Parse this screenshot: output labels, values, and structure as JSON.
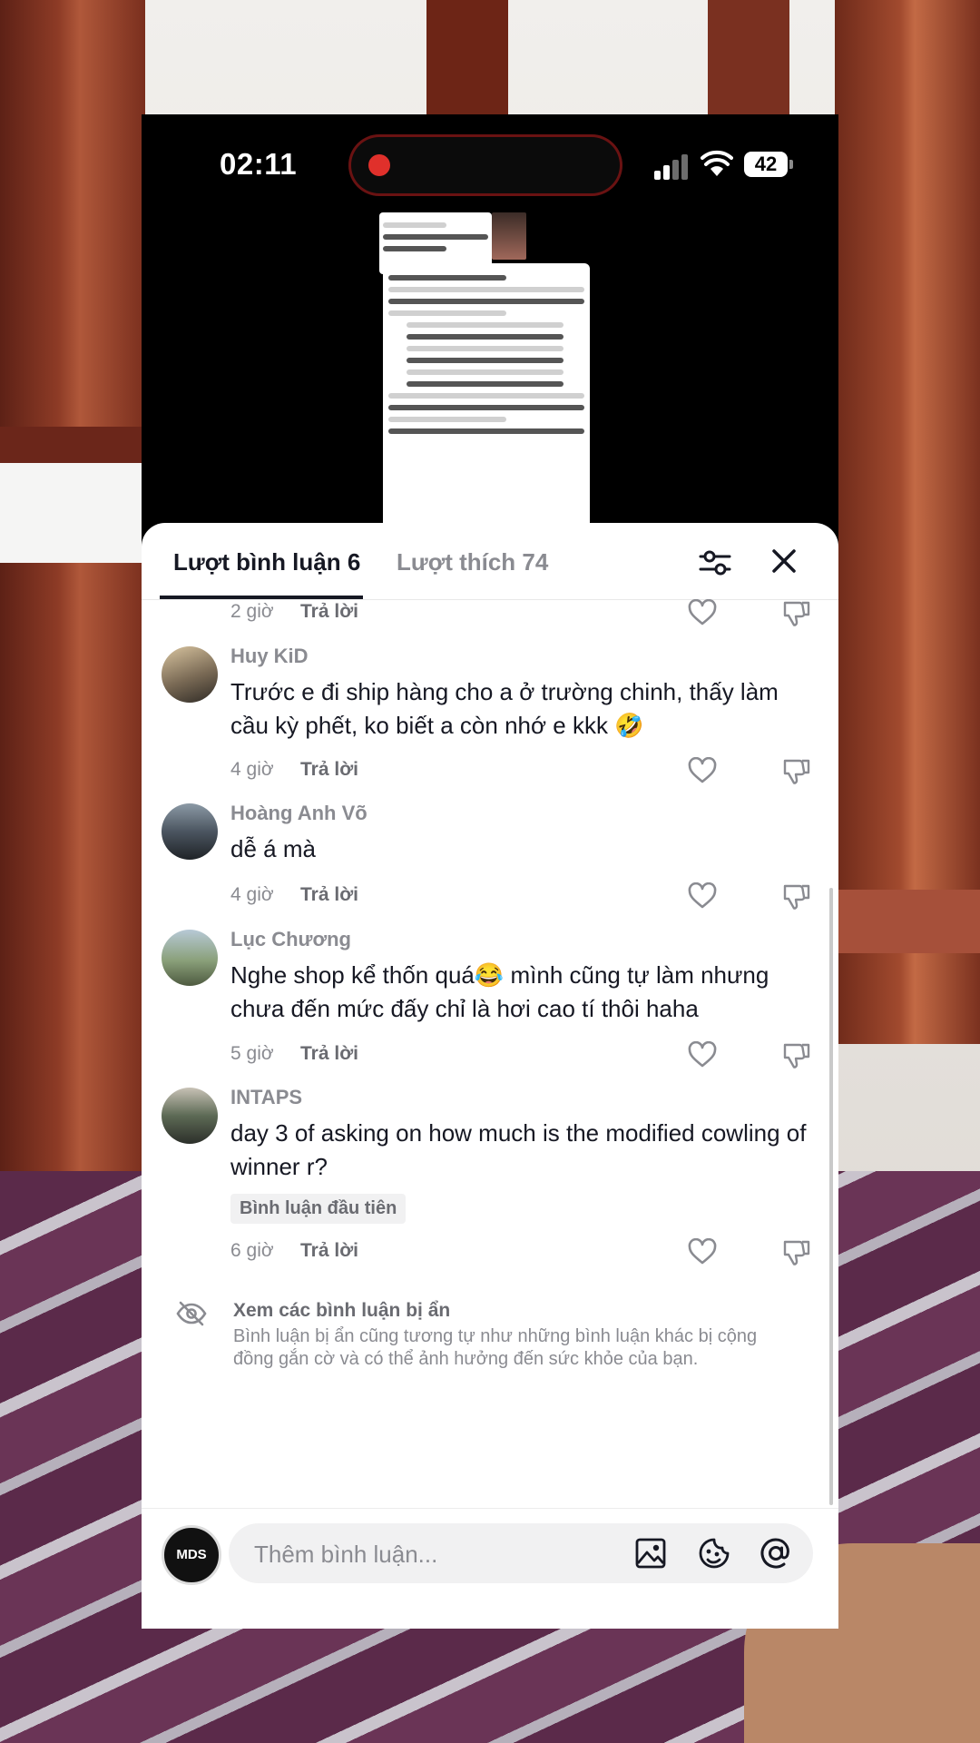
{
  "status_bar": {
    "time": "02:11",
    "battery": "42"
  },
  "tabs": {
    "comments_label": "Lượt bình luận 6",
    "likes_label": "Lượt thích 74"
  },
  "comments": [
    {
      "time": "2 giờ",
      "reply": "Trả lời"
    },
    {
      "author": "Huy KiD",
      "text": "Trước e đi ship hàng cho a ở trường chinh, thấy làm cầu kỳ phết, ko biết a còn nhớ e kkk 🤣",
      "time": "4 giờ",
      "reply": "Trả lời"
    },
    {
      "author": "Hoàng Anh Võ",
      "text": "dễ á mà",
      "time": "4 giờ",
      "reply": "Trả lời"
    },
    {
      "author": "Lục Chương",
      "text": "Nghe shop kể thốn quá😂 mình cũng tự làm nhưng chưa đến mức đấy chỉ là hơi cao tí thôi haha",
      "time": "5 giờ",
      "reply": "Trả lời"
    },
    {
      "author": "INTAPS",
      "text": "day 3 of asking on how much is the modified cowling of winner r?",
      "badge": "Bình luận đầu tiên",
      "time": "6 giờ",
      "reply": "Trả lời"
    }
  ],
  "hidden_comments": {
    "title": "Xem các bình luận bị ẩn",
    "description": "Bình luận bị ẩn cũng tương tự như những bình luận khác bị cộng đồng gắn cờ và có thể ảnh hưởng đến sức khỏe của bạn."
  },
  "composer": {
    "placeholder": "Thêm bình luận...",
    "avatar_text": "MDS"
  },
  "icons": {
    "filter": "filter-icon",
    "close": "close-icon",
    "like": "heart-icon",
    "dislike": "thumbs-down-icon",
    "hidden": "eye-off-icon",
    "image": "image-icon",
    "emoji": "emoji-icon",
    "mention": "at-icon"
  },
  "colors": {
    "primary_text": "#161823",
    "secondary_text": "#8a8b91",
    "record": "#e0302b"
  }
}
